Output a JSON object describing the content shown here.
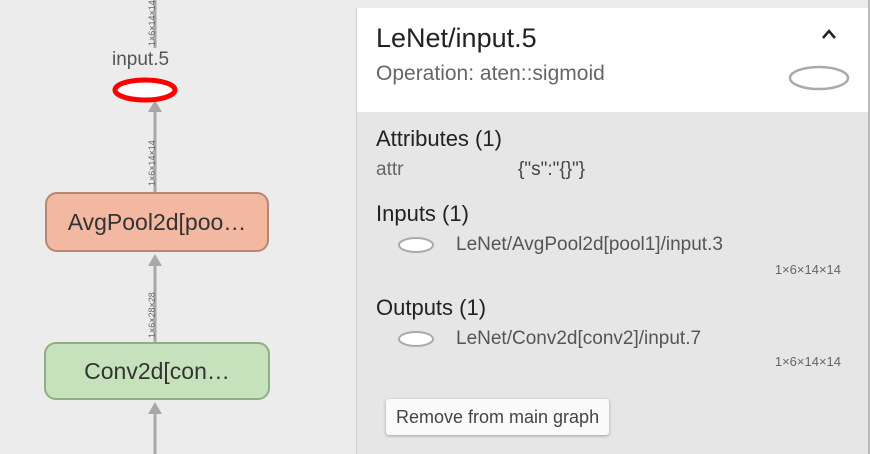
{
  "graph": {
    "nodes": {
      "op_node_label": "input.5",
      "avgpool_label": "AvgPool2d[poo…",
      "conv_label": "Conv2d[con…"
    },
    "edges": {
      "top_shape": "1×6×14×14",
      "mid_shape": "1×6×14×14",
      "lower_shape": "1×6×28×28"
    },
    "colors": {
      "avgpool_fill": "#f2b8a2",
      "conv_fill": "#c6e2bd",
      "selected_outline": "#ff0000"
    }
  },
  "panel": {
    "title": "LeNet/input.5",
    "subtitle": "Operation: aten::sigmoid",
    "collapse_icon": "chevron-up-icon",
    "attributes": {
      "heading": "Attributes (1)",
      "items": [
        {
          "key": "attr",
          "value": "{\"s\":\"{}\"}"
        }
      ]
    },
    "inputs": {
      "heading": "Inputs (1)",
      "items": [
        {
          "name": "LeNet/AvgPool2d[pool1]/input.3",
          "shape": "1×6×14×14"
        }
      ]
    },
    "outputs": {
      "heading": "Outputs (1)",
      "items": [
        {
          "name": "LeNet/Conv2d[conv2]/input.7",
          "shape": "1×6×14×14"
        }
      ]
    },
    "remove_button": "Remove from main graph"
  }
}
